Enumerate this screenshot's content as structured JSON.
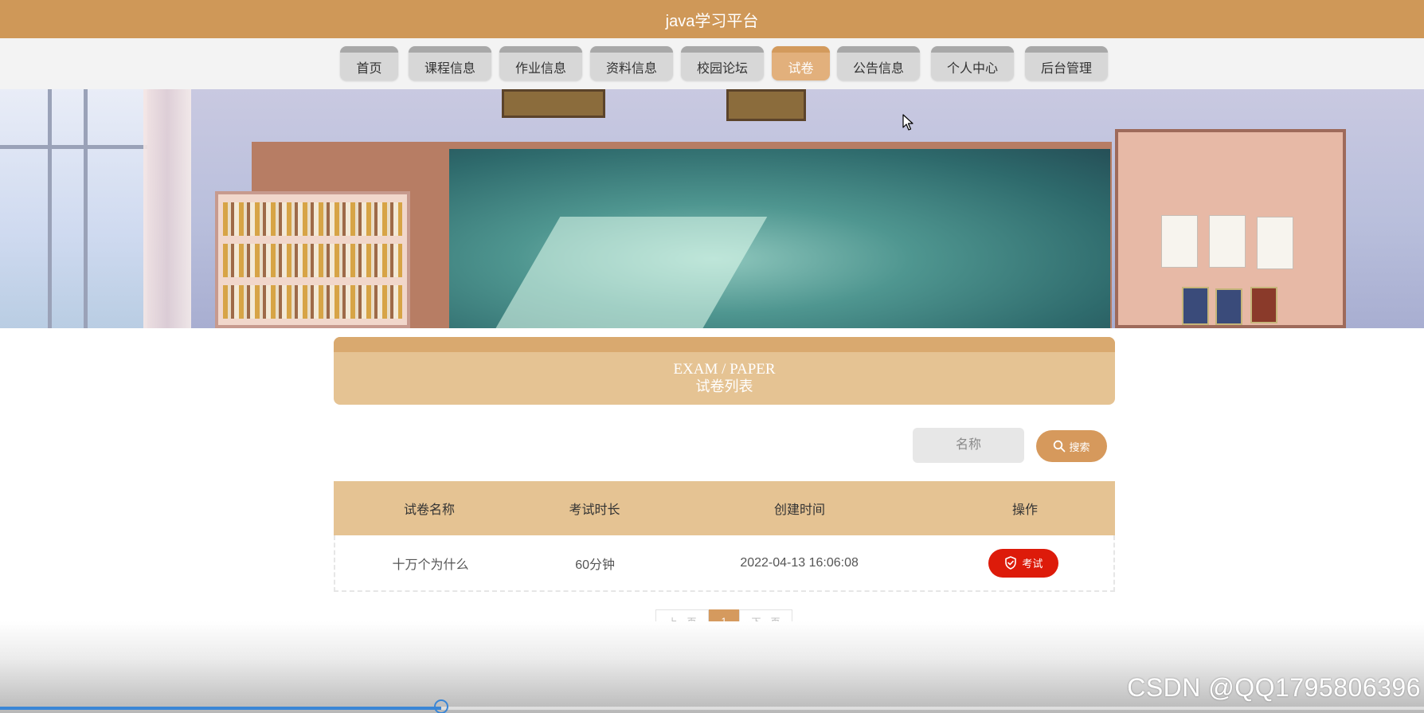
{
  "header": {
    "title": "java学习平台"
  },
  "nav": {
    "items": [
      {
        "label": "首页",
        "active": false
      },
      {
        "label": "课程信息",
        "active": false
      },
      {
        "label": "作业信息",
        "active": false
      },
      {
        "label": "资料信息",
        "active": false
      },
      {
        "label": "校园论坛",
        "active": false
      },
      {
        "label": "试卷",
        "active": true
      },
      {
        "label": "公告信息",
        "active": false
      },
      {
        "label": "个人中心",
        "active": false
      },
      {
        "label": "后台管理",
        "active": false
      }
    ]
  },
  "section": {
    "title_en": "EXAM / PAPER",
    "title_cn": "试卷列表"
  },
  "search": {
    "placeholder": "名称",
    "button_label": "搜索",
    "button_icon": "search-icon"
  },
  "table": {
    "headers": [
      "试卷名称",
      "考试时长",
      "创建时间",
      "操作"
    ],
    "rows": [
      {
        "name": "十万个为什么",
        "duration": "60分钟",
        "created": "2022-04-13 16:06:08",
        "action_label": "考试",
        "action_icon": "shield-check-icon"
      }
    ]
  },
  "pagination": {
    "prev": "上一页",
    "current": "1",
    "next": "下一页"
  },
  "watermark": "CSDN @QQ1795806396",
  "video_progress": {
    "fraction": 0.31
  },
  "colors": {
    "accent": "#cf9858",
    "nav_active": "#e2b07c",
    "panel": "#e5c393",
    "danger": "#dd1b0a",
    "progress": "#3a86d6"
  }
}
